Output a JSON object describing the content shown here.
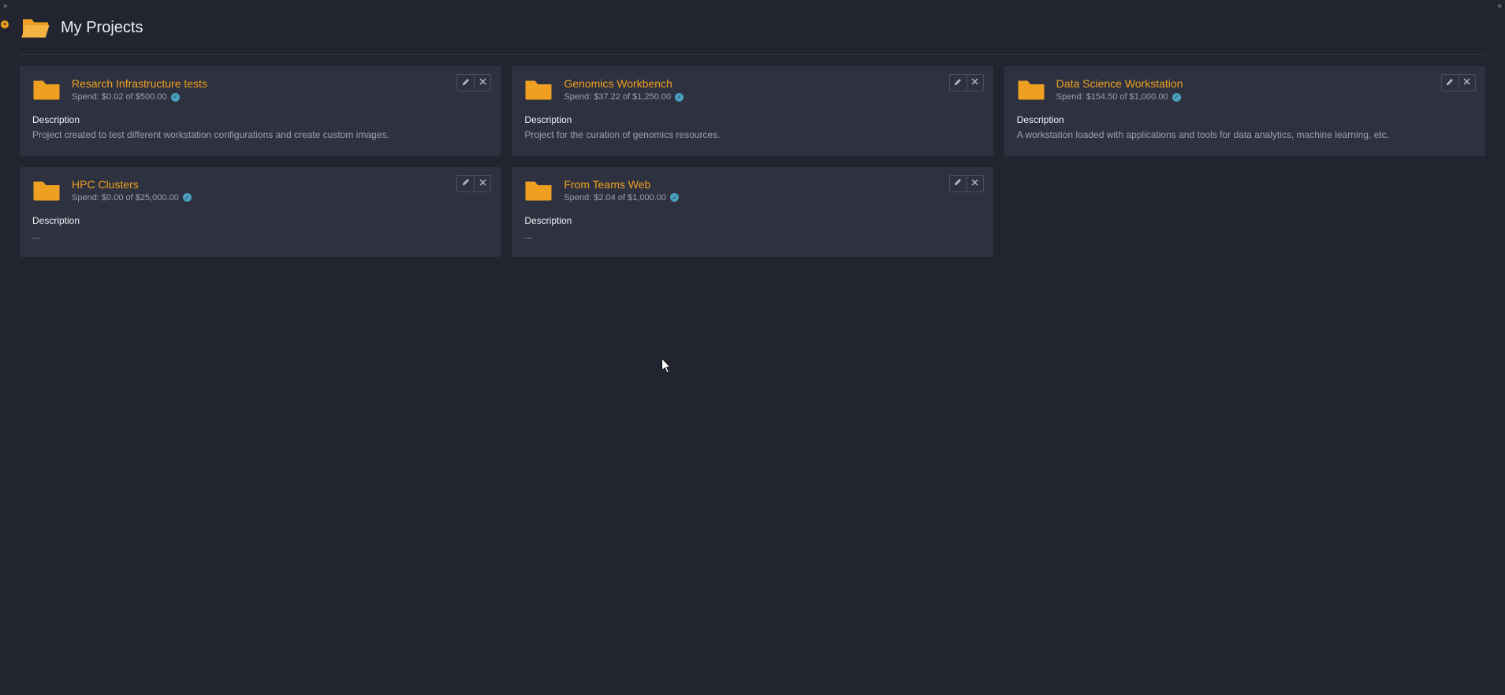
{
  "header": {
    "title": "My Projects"
  },
  "labels": {
    "description": "Description"
  },
  "projects": [
    {
      "name": "Resarch Infrastructure tests",
      "spend": "Spend: $0.02 of $500.00",
      "description": "Project created to test different workstation configurations and create custom images."
    },
    {
      "name": "Genomics Workbench",
      "spend": "Spend: $37.22 of $1,250.00",
      "description": "Project for the curation of genomics resources."
    },
    {
      "name": "Data Science Workstation",
      "spend": "Spend: $154.50 of $1,000.00",
      "description": "A workstation loaded with applications and tools for data analytics, machine learning, etc."
    },
    {
      "name": "HPC Clusters",
      "spend": "Spend: $0.00 of $25,000.00",
      "description": "..."
    },
    {
      "name": "From Teams Web",
      "spend": "Spend: $2.04 of $1,000.00",
      "description": "..."
    }
  ]
}
